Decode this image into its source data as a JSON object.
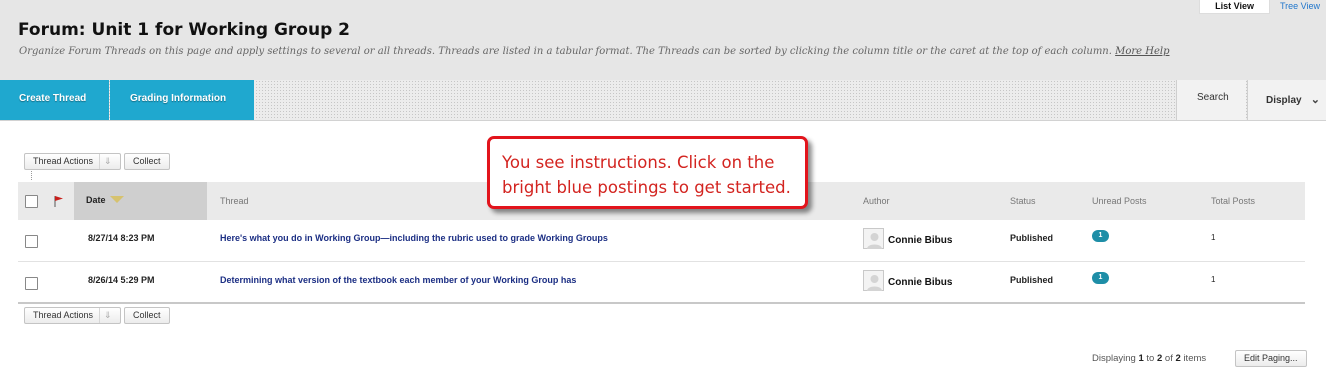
{
  "header": {
    "title": "Forum: Unit 1 for Working Group 2",
    "description": "Organize Forum Threads on this page and apply settings to several or all threads. Threads are listed in a tabular format. The Threads can be sorted by clicking the column title or the caret at the top of each column.",
    "more_help": "More Help",
    "views": {
      "list": "List View",
      "tree": "Tree View"
    }
  },
  "action_bar": {
    "create_thread": "Create Thread",
    "grading_information": "Grading Information",
    "search": "Search",
    "display": "Display"
  },
  "toolbar": {
    "thread_actions": "Thread Actions",
    "collect": "Collect"
  },
  "table": {
    "columns": {
      "date": "Date",
      "thread": "Thread",
      "author": "Author",
      "status": "Status",
      "unread": "Unread Posts",
      "total": "Total Posts"
    },
    "rows": [
      {
        "date": "8/27/14 8:23 PM",
        "thread": "Here's what you do in Working Group—including the rubric used to grade Working Groups",
        "author": "Connie Bibus",
        "status": "Published",
        "unread": "1",
        "total": "1"
      },
      {
        "date": "8/26/14 5:29 PM",
        "thread": "Determining what version of the textbook each member of your Working Group has",
        "author": "Connie Bibus",
        "status": "Published",
        "unread": "1",
        "total": "1"
      }
    ]
  },
  "callout": {
    "line1": "You see instructions. Click on the",
    "line2": "bright blue postings to get started."
  },
  "paging": {
    "prefix": "Displaying",
    "from": "1",
    "to_word": "to",
    "to": "2",
    "of_word": "of",
    "total": "2",
    "suffix": "items",
    "edit": "Edit Paging..."
  },
  "colors": {
    "accent": "#1fa8cf",
    "badge": "#1e8ea7",
    "callout": "#e2141c",
    "link": "#1c2f84"
  }
}
